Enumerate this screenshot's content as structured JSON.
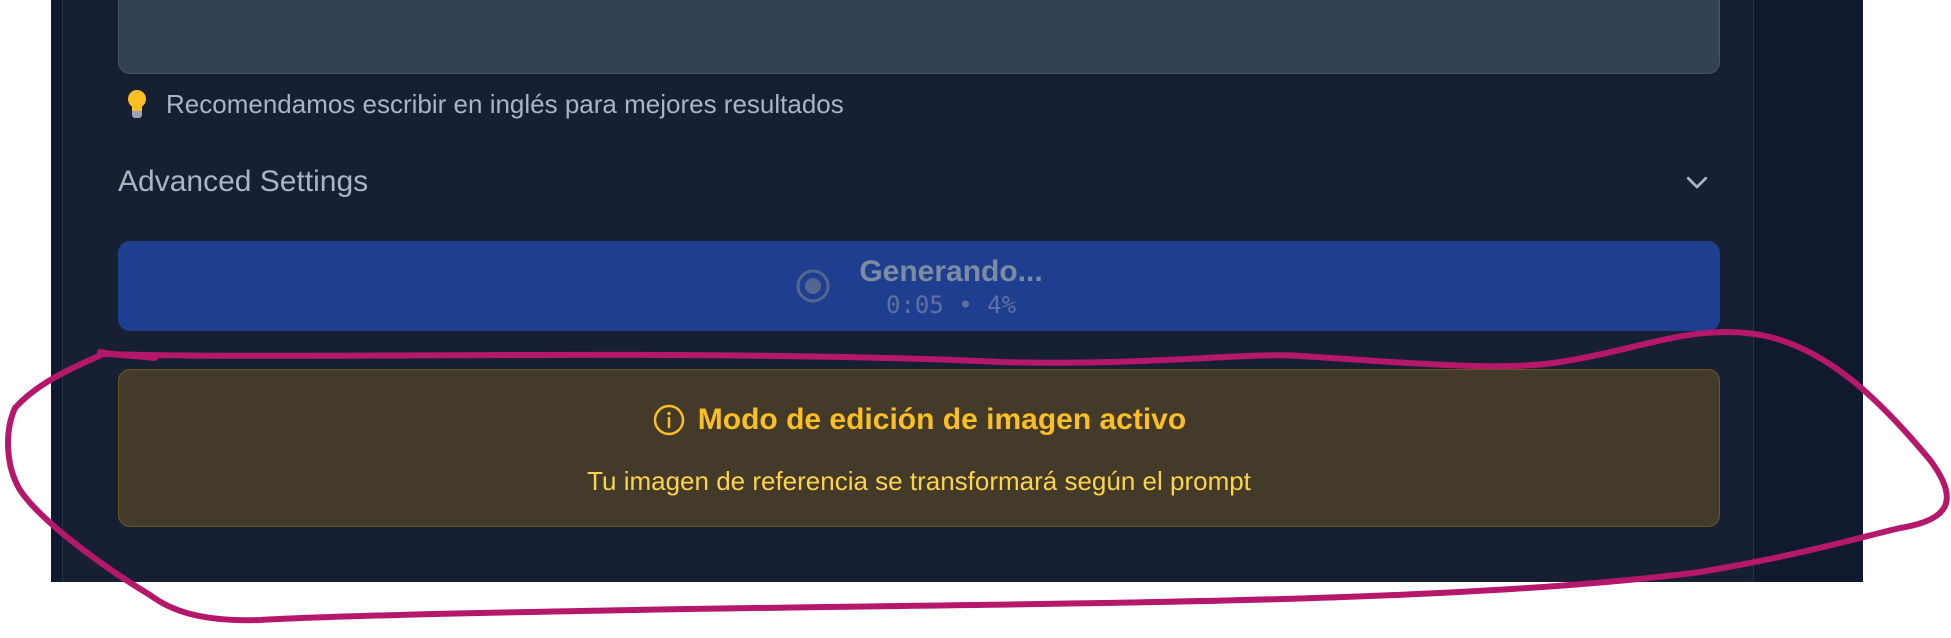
{
  "prompt_section": {
    "tip_icon": "lightbulb-icon",
    "tip_text": "Recomendamos escribir en inglés para mejores resultados"
  },
  "advanced_settings": {
    "label": "Advanced Settings",
    "expanded": false,
    "icon": "chevron-down-icon"
  },
  "generate_button": {
    "label": "Generando...",
    "status": "0:05 • 4%",
    "elapsed": "0:05",
    "progress_percent": 4,
    "disabled": true,
    "color": "#1e3f8f"
  },
  "edit_mode_notice": {
    "icon": "info-circle-icon",
    "title": "Modo de edición de imagen activo",
    "message": "Tu imagen de referencia se transformará según el prompt",
    "accent_color": "#fbbf24"
  },
  "annotation": {
    "type": "freehand-ellipse",
    "color": "#b5176b"
  }
}
